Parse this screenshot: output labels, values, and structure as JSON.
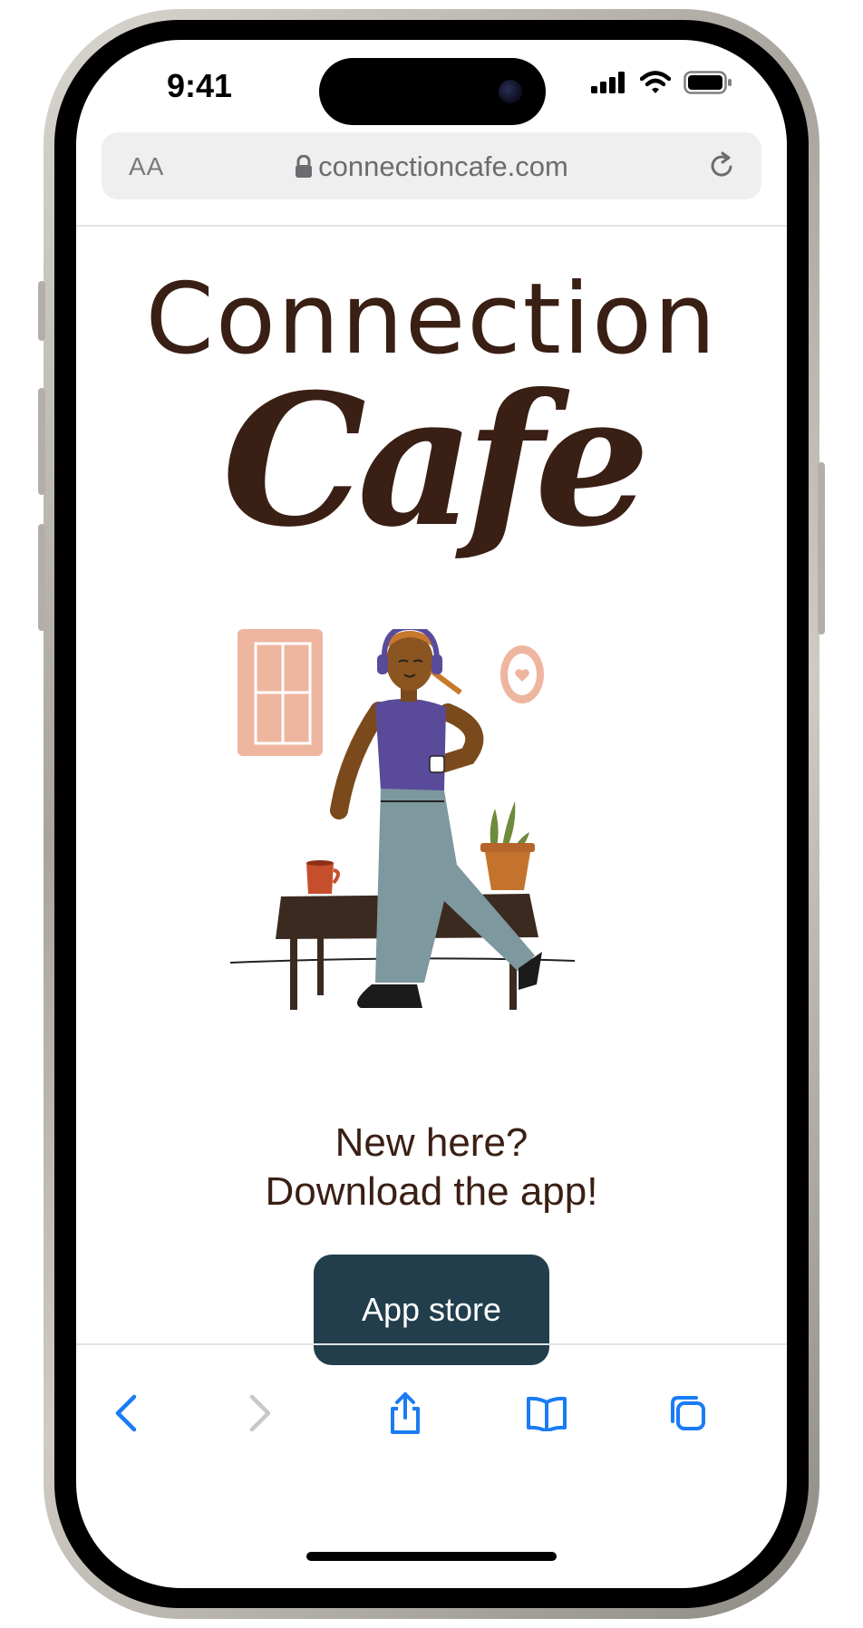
{
  "status_bar": {
    "time": "9:41"
  },
  "browser": {
    "text_size_label": "AA",
    "url": "connectioncafe.com"
  },
  "page": {
    "brand_line1": "Connection",
    "brand_line2": "Cafe",
    "cta_line1": "New here?",
    "cta_line2": "Download the app!",
    "app_store_button": "App store"
  },
  "colors": {
    "brand_brown": "#3a1f14",
    "button_bg": "#223e4c",
    "ios_blue": "#1a7cf3"
  },
  "toolbar": {
    "icons": [
      "back-icon",
      "forward-icon",
      "share-icon",
      "bookmarks-icon",
      "tabs-icon"
    ]
  }
}
